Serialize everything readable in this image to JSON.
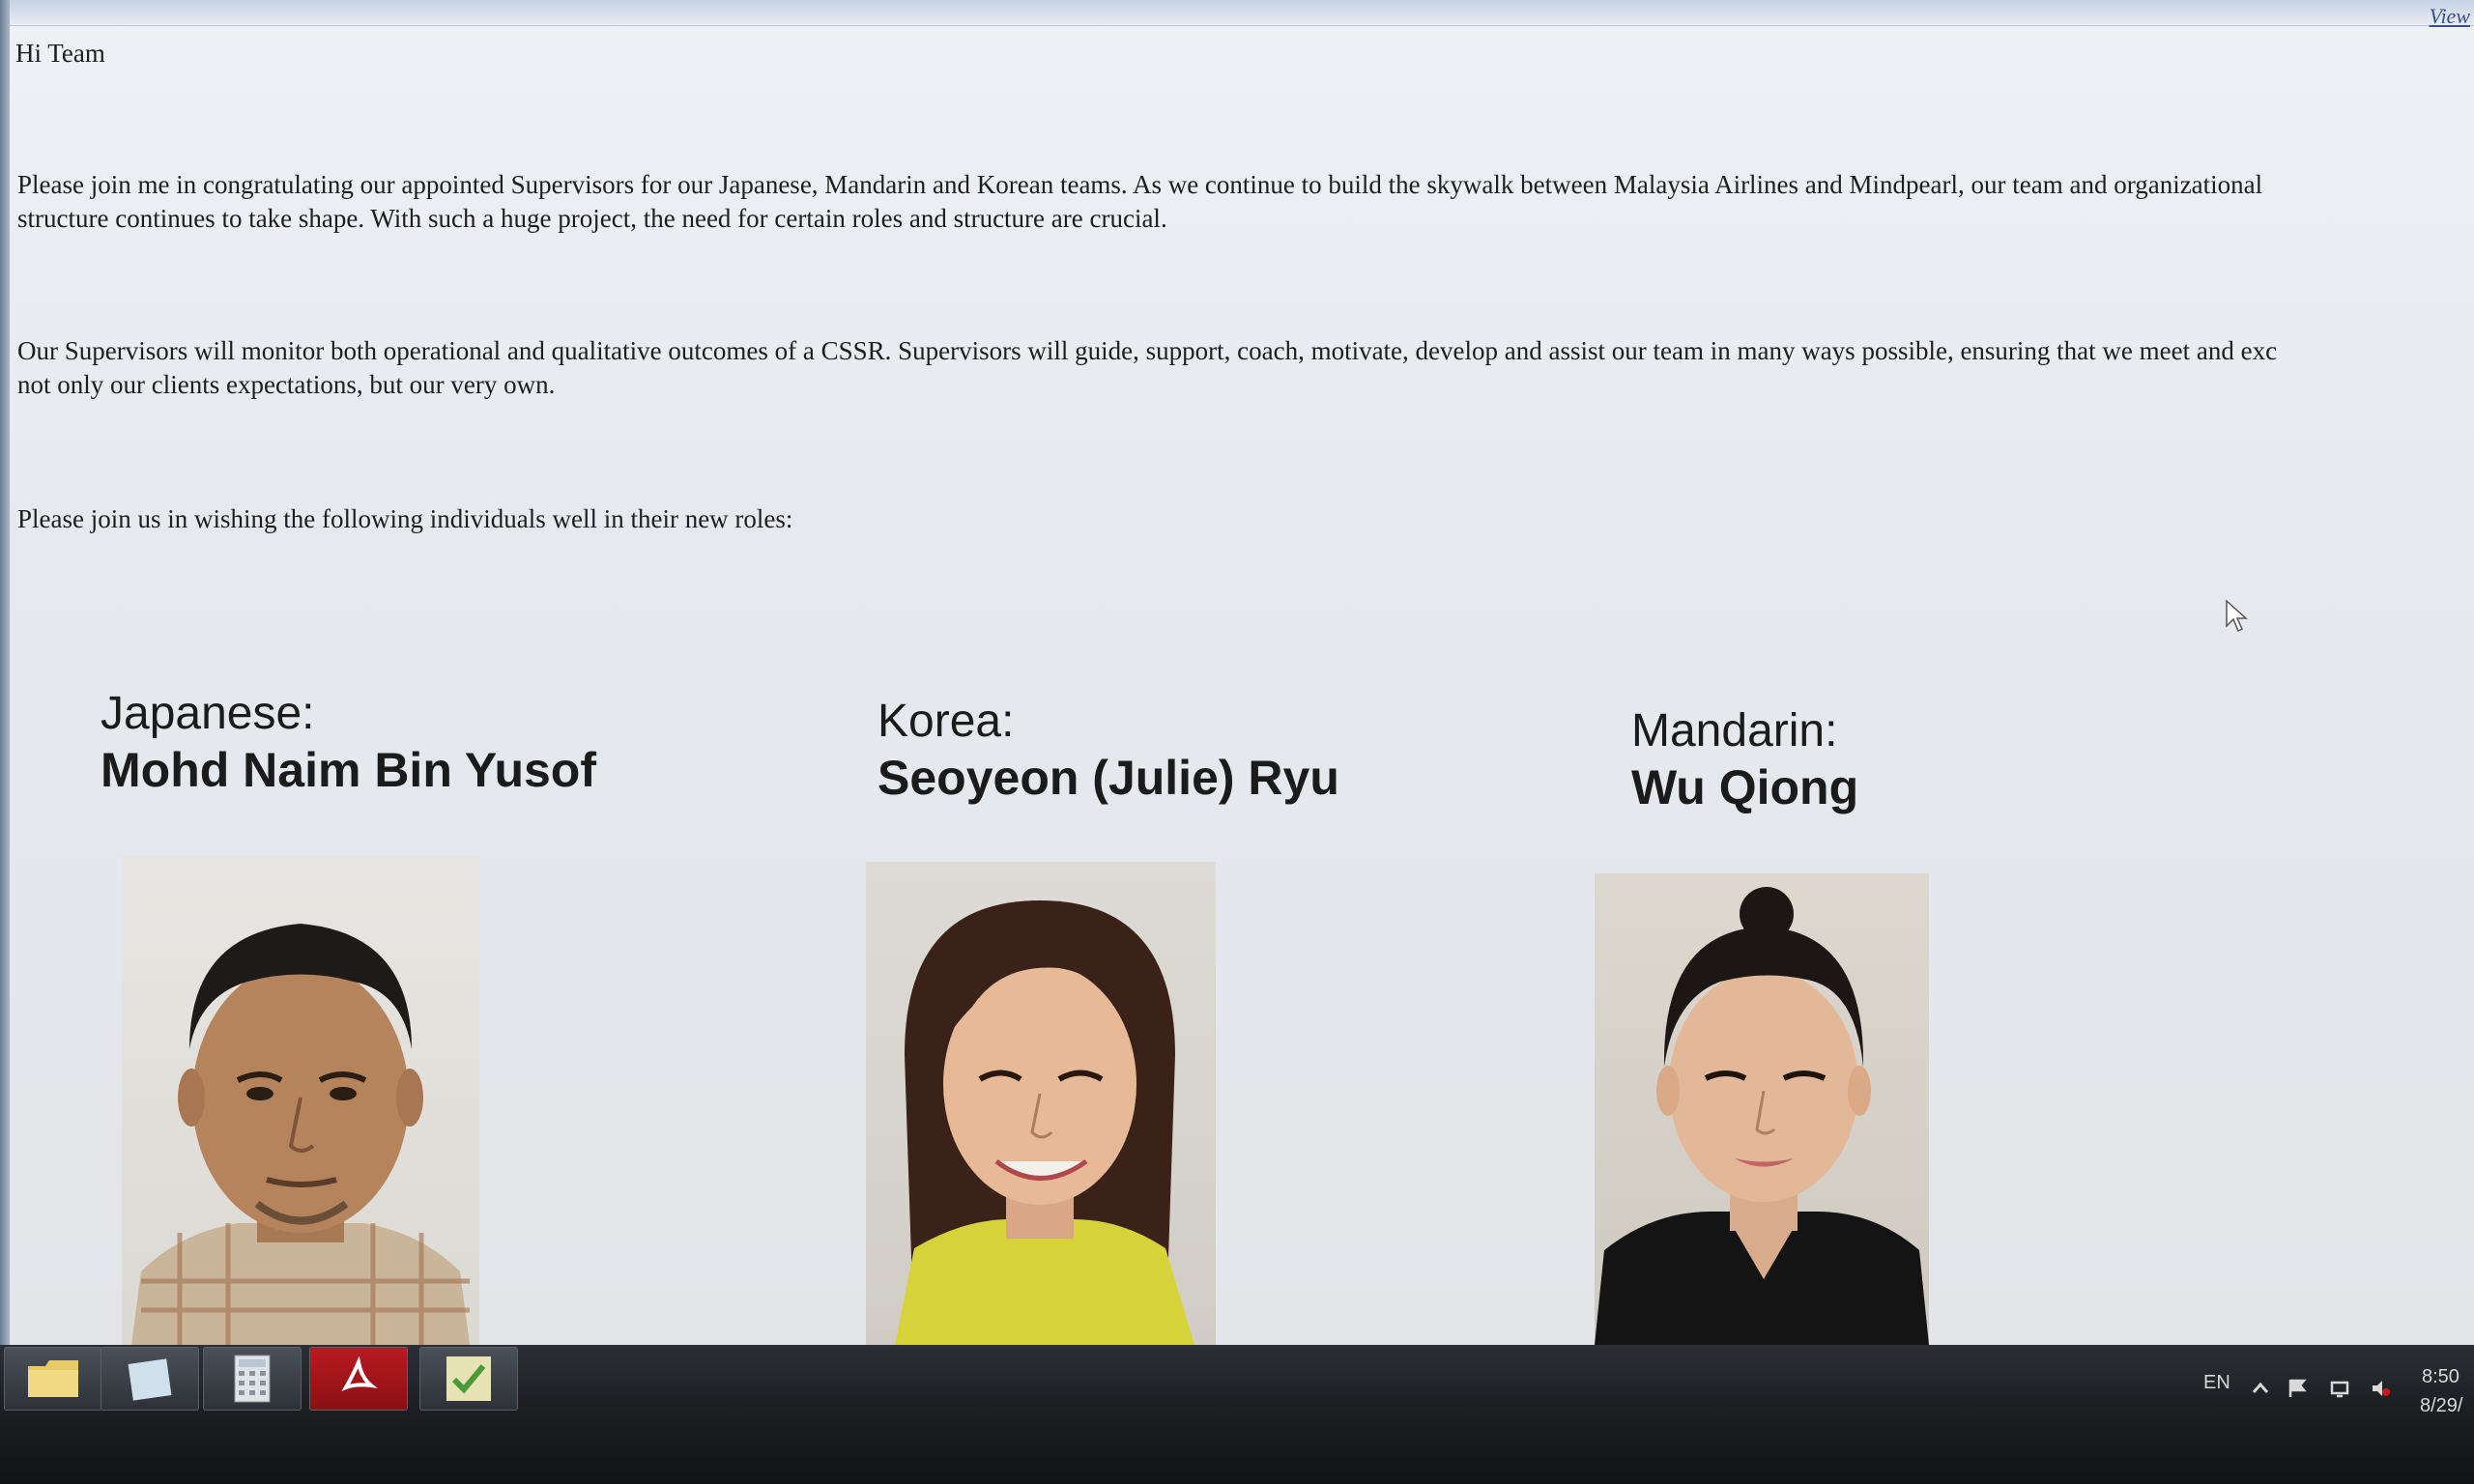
{
  "email": {
    "view_link": "View ",
    "greeting": "Hi Team",
    "paragraph1_line1": "Please join me in congratulating our appointed Supervisors for our Japanese, Mandarin and Korean teams. As we continue to build the skywalk between Malaysia Airlines and Mindpearl, our team and organizational",
    "paragraph1_line2": "structure continues to take shape. With such a huge project, the need for certain roles and structure are crucial.",
    "paragraph2_line1": "Our Supervisors will monitor both operational and qualitative outcomes of a CSSR. Supervisors will guide, support, coach, motivate, develop and assist our team in many ways possible, ensuring that we meet and exc",
    "paragraph2_line2": "not only our clients expectations, but our very own.",
    "paragraph3": "Please join us in wishing the following individuals well in their new roles:"
  },
  "supervisors": [
    {
      "language": "Japanese:",
      "name": "Mohd Naim Bin Yusof"
    },
    {
      "language": "Korea:",
      "name": "Seoyeon (Julie) Ryu"
    },
    {
      "language": "Mandarin:",
      "name": "Wu Qiong"
    }
  ],
  "taskbar": {
    "apps": [
      "file-explorer-icon",
      "notepad-icon",
      "calculator-icon",
      "acrobat-reader-icon",
      "task-app-icon"
    ],
    "language": "EN",
    "time": "8:50",
    "date": "8/29/"
  },
  "colors": {
    "taskbar": "#1c1e22",
    "page_bg": "#e6e9ee",
    "acrobat_red": "#c8161d"
  }
}
